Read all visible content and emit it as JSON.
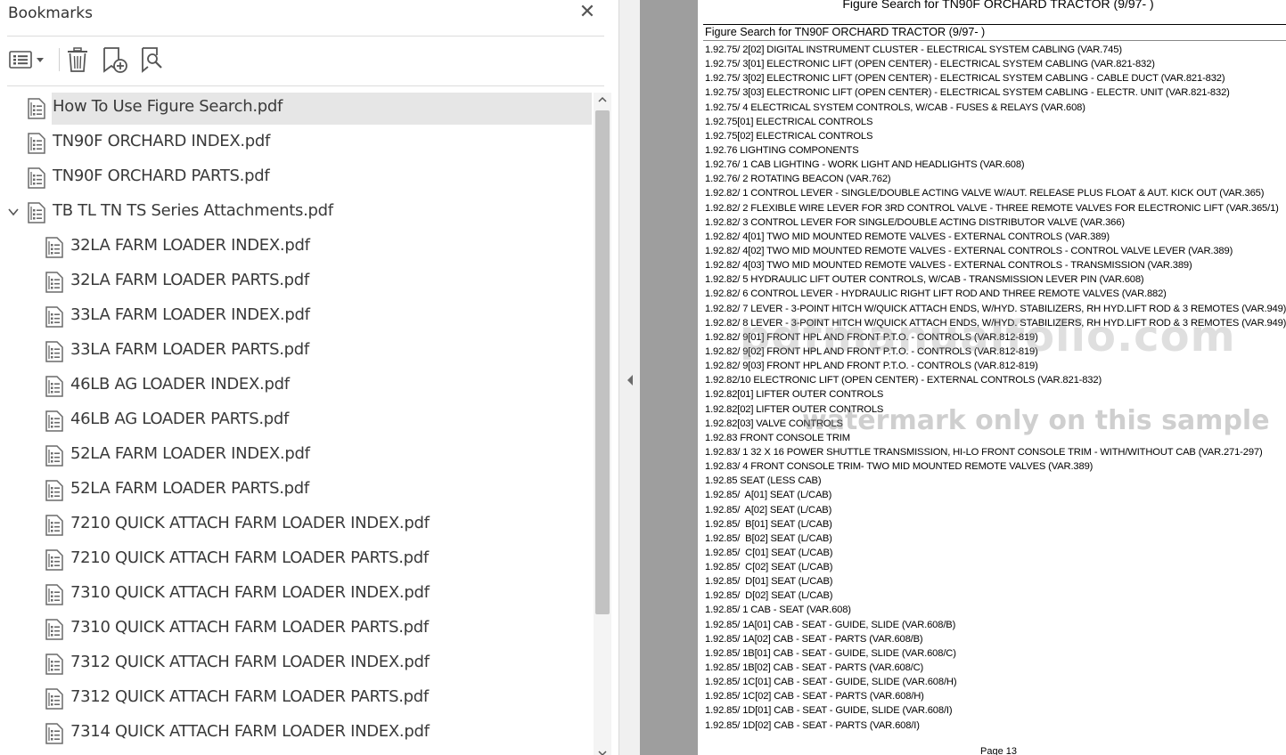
{
  "bookmarks": {
    "title": "Bookmarks",
    "close_glyph": "✕",
    "toolbar": {
      "options_icon": "list-options-icon",
      "delete_icon": "trash-icon",
      "new_bookmark_icon": "add-bookmark-icon",
      "find_icon": "find-bookmark-icon"
    },
    "items": [
      {
        "label": "How To Use Figure Search.pdf",
        "level": 0,
        "selected": true
      },
      {
        "label": "TN90F ORCHARD INDEX.pdf",
        "level": 0
      },
      {
        "label": "TN90F ORCHARD PARTS.pdf",
        "level": 0
      },
      {
        "label": "TB TL TN TS Series Attachments.pdf",
        "level": 0,
        "expanded": true
      },
      {
        "label": "32LA FARM LOADER INDEX.pdf",
        "level": 1
      },
      {
        "label": "32LA FARM LOADER PARTS.pdf",
        "level": 1
      },
      {
        "label": "33LA FARM LOADER INDEX.pdf",
        "level": 1
      },
      {
        "label": "33LA FARM LOADER PARTS.pdf",
        "level": 1
      },
      {
        "label": "46LB AG LOADER INDEX.pdf",
        "level": 1
      },
      {
        "label": "46LB AG LOADER PARTS.pdf",
        "level": 1
      },
      {
        "label": "52LA FARM LOADER INDEX.pdf",
        "level": 1
      },
      {
        "label": "52LA FARM LOADER PARTS.pdf",
        "level": 1
      },
      {
        "label": "7210 QUICK ATTACH FARM LOADER INDEX.pdf",
        "level": 1
      },
      {
        "label": "7210 QUICK ATTACH FARM LOADER PARTS.pdf",
        "level": 1
      },
      {
        "label": "7310 QUICK ATTACH FARM LOADER INDEX.pdf",
        "level": 1
      },
      {
        "label": "7310 QUICK ATTACH FARM LOADER PARTS.pdf",
        "level": 1
      },
      {
        "label": "7312 QUICK ATTACH FARM LOADER INDEX.pdf",
        "level": 1
      },
      {
        "label": "7312 QUICK ATTACH FARM LOADER PARTS.pdf",
        "level": 1
      },
      {
        "label": "7314 QUICK ATTACH FARM LOADER INDEX.pdf",
        "level": 1
      }
    ]
  },
  "document": {
    "header": "Figure Search for TN90F ORCHARD TRACTOR (9/97- )",
    "table_title": "Figure Search for TN90F ORCHARD TRACTOR (9/97- )",
    "page_number": "Page 13",
    "watermark_domain": "pdfmanualfolio.com",
    "watermark_note": "watermark only on this sample",
    "entries": [
      "1.92.75/ 2[02] DIGITAL INSTRUMENT CLUSTER - ELECTRICAL SYSTEM CABLING (VAR.745)",
      "1.92.75/ 3[01] ELECTRONIC LIFT (OPEN CENTER) - ELECTRICAL SYSTEM CABLING (VAR.821-832)",
      "1.92.75/ 3[02] ELECTRONIC LIFT (OPEN CENTER) - ELECTRICAL SYSTEM CABLING - CABLE DUCT (VAR.821-832)",
      "1.92.75/ 3[03] ELECTRONIC LIFT (OPEN CENTER) - ELECTRICAL SYSTEM CABLING - ELECTR. UNIT (VAR.821-832)",
      "1.92.75/ 4 ELECTRICAL SYSTEM CONTROLS, W/CAB - FUSES & RELAYS (VAR.608)",
      "1.92.75[01] ELECTRICAL CONTROLS",
      "1.92.75[02] ELECTRICAL CONTROLS",
      "1.92.76 LIGHTING COMPONENTS",
      "1.92.76/ 1 CAB LIGHTING - WORK LIGHT AND HEADLIGHTS (VAR.608)",
      "1.92.76/ 2 ROTATING BEACON (VAR.762)",
      "1.92.82/ 1 CONTROL LEVER - SINGLE/DOUBLE ACTING VALVE W/AUT. RELEASE PLUS FLOAT & AUT. KICK OUT (VAR.365)",
      "1.92.82/ 2 FLEXIBLE WIRE LEVER FOR 3RD CONTROL VALVE - THREE REMOTE VALVES FOR ELECTRONIC LIFT (VAR.365/1)",
      "1.92.82/ 3 CONTROL LEVER FOR SINGLE/DOUBLE ACTING DISTRIBUTOR VALVE (VAR.366)",
      "1.92.82/ 4[01] TWO MID MOUNTED REMOTE VALVES - EXTERNAL CONTROLS (VAR.389)",
      "1.92.82/ 4[02] TWO MID MOUNTED REMOTE VALVES - EXTERNAL CONTROLS - CONTROL VALVE LEVER (VAR.389)",
      "1.92.82/ 4[03] TWO MID MOUNTED REMOTE VALVES - EXTERNAL CONTROLS - TRANSMISSION (VAR.389)",
      "1.92.82/ 5 HYDRAULIC LIFT OUTER CONTROLS, W/CAB - TRANSMISSION LEVER PIN (VAR.608)",
      "1.92.82/ 6 CONTROL LEVER - HYDRAULIC RIGHT LIFT ROD AND THREE REMOTE VALVES (VAR.882)",
      "1.92.82/ 7 LEVER - 3-POINT HITCH W/QUICK ATTACH ENDS, W/HYD. STABILIZERS, RH HYD.LIFT ROD & 3 REMOTES (VAR.949)",
      "1.92.82/ 8 LEVER - 3-POINT HITCH W/QUICK ATTACH ENDS, W/HYD. STABILIZERS, RH HYD.LIFT ROD & 3 REMOTES (VAR.949)",
      "1.92.82/ 9[01] FRONT HPL AND FRONT P.T.O. - CONTROLS (VAR.812-819)",
      "1.92.82/ 9[02] FRONT HPL AND FRONT P.T.O. - CONTROLS (VAR.812-819)",
      "1.92.82/ 9[03] FRONT HPL AND FRONT P.T.O. - CONTROLS (VAR.812-819)",
      "1.92.82/10 ELECTRONIC LIFT (OPEN CENTER) - EXTERNAL CONTROLS (VAR.821-832)",
      "1.92.82[01] LIFTER OUTER CONTROLS",
      "1.92.82[02] LIFTER OUTER CONTROLS",
      "1.92.82[03] VALVE CONTROLS",
      "1.92.83 FRONT CONSOLE TRIM",
      "1.92.83/ 1 32 X 16 POWER SHUTTLE TRANSMISSION, HI-LO FRONT CONSOLE TRIM - WITH/WITHOUT CAB (VAR.271-297)",
      "1.92.83/ 4 FRONT CONSOLE TRIM- TWO MID MOUNTED REMOTE VALVES (VAR.389)",
      "1.92.85 SEAT (LESS CAB)",
      "1.92.85/  A[01] SEAT (L/CAB)",
      "1.92.85/  A[02] SEAT (L/CAB)",
      "1.92.85/  B[01] SEAT (L/CAB)",
      "1.92.85/  B[02] SEAT (L/CAB)",
      "1.92.85/  C[01] SEAT (L/CAB)",
      "1.92.85/  C[02] SEAT (L/CAB)",
      "1.92.85/  D[01] SEAT (L/CAB)",
      "1.92.85/  D[02] SEAT (L/CAB)",
      "1.92.85/ 1 CAB - SEAT (VAR.608)",
      "1.92.85/ 1A[01] CAB - SEAT - GUIDE, SLIDE (VAR.608/B)",
      "1.92.85/ 1A[02] CAB - SEAT - PARTS (VAR.608/B)",
      "1.92.85/ 1B[01] CAB - SEAT - GUIDE, SLIDE (VAR.608/C)",
      "1.92.85/ 1B[02] CAB - SEAT - PARTS (VAR.608/C)",
      "1.92.85/ 1C[01] CAB - SEAT - GUIDE, SLIDE (VAR.608/H)",
      "1.92.85/ 1C[02] CAB - SEAT - PARTS (VAR.608/H)",
      "1.92.85/ 1D[01] CAB - SEAT - GUIDE, SLIDE (VAR.608/I)",
      "1.92.85/ 1D[02] CAB - SEAT - PARTS (VAR.608/I)"
    ]
  }
}
